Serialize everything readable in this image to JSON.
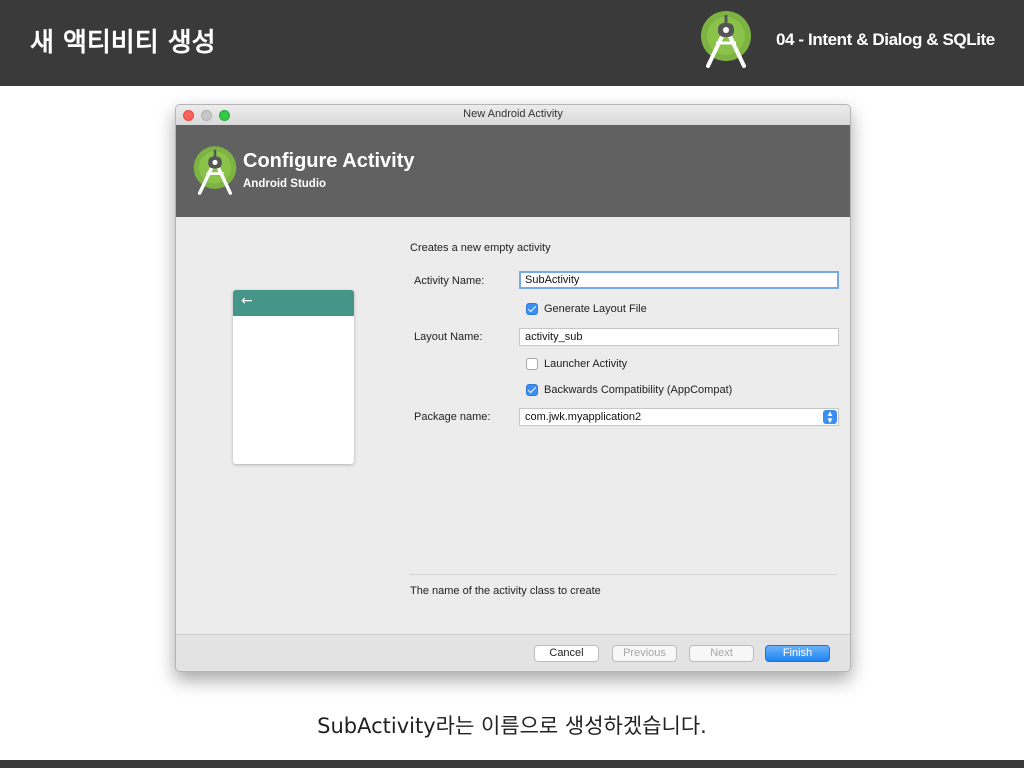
{
  "slide": {
    "title": "새 액티비티 생성",
    "subtitle": "04 - Intent & Dialog & SQLite",
    "caption": "SubActivity라는 이름으로 생성하겠습니다."
  },
  "window": {
    "title": "New Android Activity",
    "header_title": "Configure Activity",
    "header_subtitle": "Android Studio"
  },
  "form": {
    "intro": "Creates a new empty activity",
    "activity_name_label": "Activity Name:",
    "activity_name_value": "SubActivity",
    "generate_layout_label": "Generate Layout File",
    "generate_layout_checked": true,
    "layout_name_label": "Layout Name:",
    "layout_name_value": "activity_sub",
    "launcher_label": "Launcher Activity",
    "launcher_checked": false,
    "backcompat_label": "Backwards Compatibility (AppCompat)",
    "backcompat_checked": true,
    "package_label": "Package name:",
    "package_value": "com.jwk.myapplication2",
    "help_text": "The name of the activity class to create"
  },
  "buttons": {
    "cancel": "Cancel",
    "previous": "Previous",
    "next": "Next",
    "finish": "Finish"
  },
  "icons": {
    "android_studio_logo": "android-studio-logo",
    "back_arrow": "←",
    "select_arrows": "⌃⌄"
  },
  "colors": {
    "topbar": "#3a3a3a",
    "header": "#616161",
    "preview_toolbar": "#459688",
    "accent_blue": "#3b8ef2",
    "logo_green": "#7cb342"
  }
}
